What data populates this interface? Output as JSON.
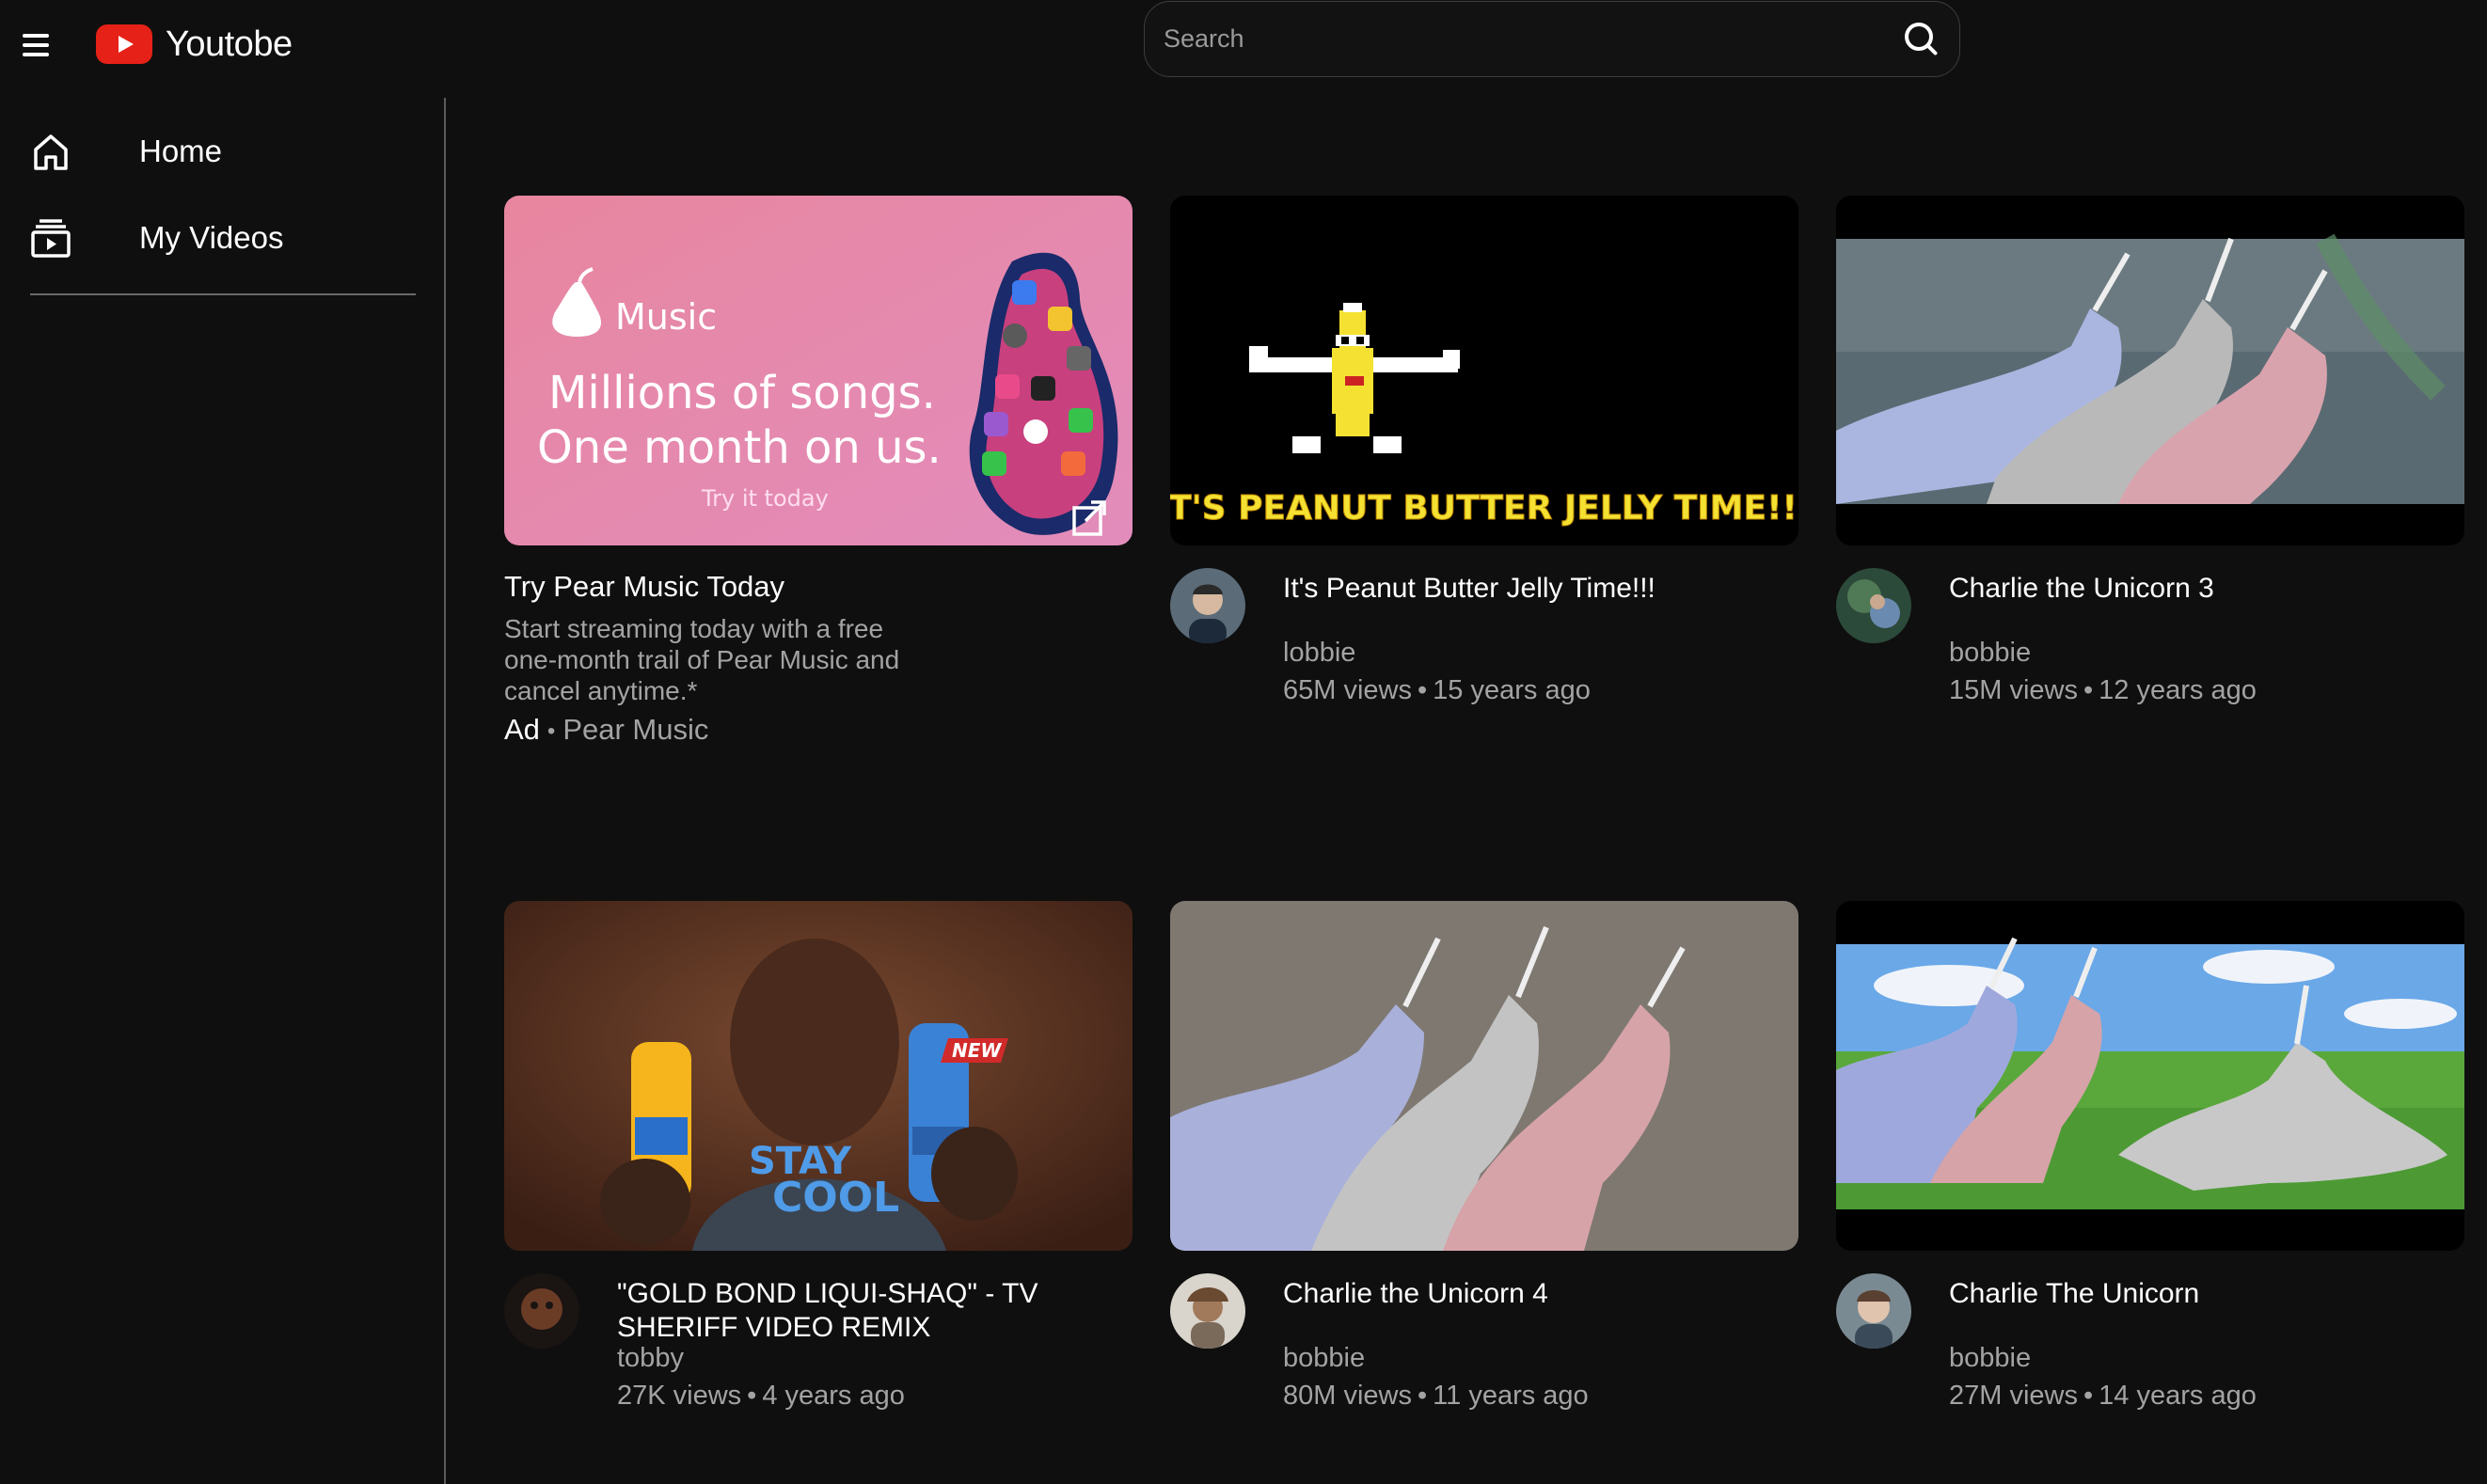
{
  "header": {
    "app_name": "Youtobe",
    "search_placeholder": "Search",
    "search_value": ""
  },
  "sidebar": {
    "items": [
      {
        "label": "Home",
        "icon": "home-icon"
      },
      {
        "label": "My Videos",
        "icon": "video-library-icon"
      }
    ]
  },
  "ad": {
    "title": "Try Pear Music Today",
    "description": "Start streaming today with a free one-month trail of Pear Music and cancel anytime.*",
    "ad_label": "Ad",
    "advertiser": "Pear Music",
    "thumb": {
      "brand": "Music",
      "headline_1": "Millions of songs.",
      "headline_2": "One month on us.",
      "cta": "Try it today"
    }
  },
  "videos": [
    {
      "title": "It's Peanut Butter Jelly Time!!!",
      "channel": "lobbie",
      "views": "65M views",
      "age": "15 years ago",
      "thumb_caption": "IT'S PEANUT BUTTER JELLY TIME!!!"
    },
    {
      "title": "Charlie the Unicorn 3",
      "channel": "bobbie",
      "views": "15M views",
      "age": "12 years ago"
    },
    {
      "title": "\"GOLD BOND LIQUI-SHAQ\" - TV SHERIFF VIDEO REMIX",
      "channel": "tobby",
      "views": "27K views",
      "age": "4 years ago",
      "thumb_text_1": "STAY",
      "thumb_text_2": "COOL",
      "thumb_badge": "NEW"
    },
    {
      "title": "Charlie the Unicorn 4",
      "channel": "bobbie",
      "views": "80M views",
      "age": "11 years ago"
    },
    {
      "title": "Charlie The Unicorn",
      "channel": "bobbie",
      "views": "27M views",
      "age": "14 years ago"
    }
  ],
  "colors": {
    "background": "#0f0f0f",
    "brand_red": "#e62117",
    "secondary_text": "#a3a3a3",
    "ad_gradient_start": "#e88aa6",
    "ad_gradient_end": "#e78fb8"
  }
}
